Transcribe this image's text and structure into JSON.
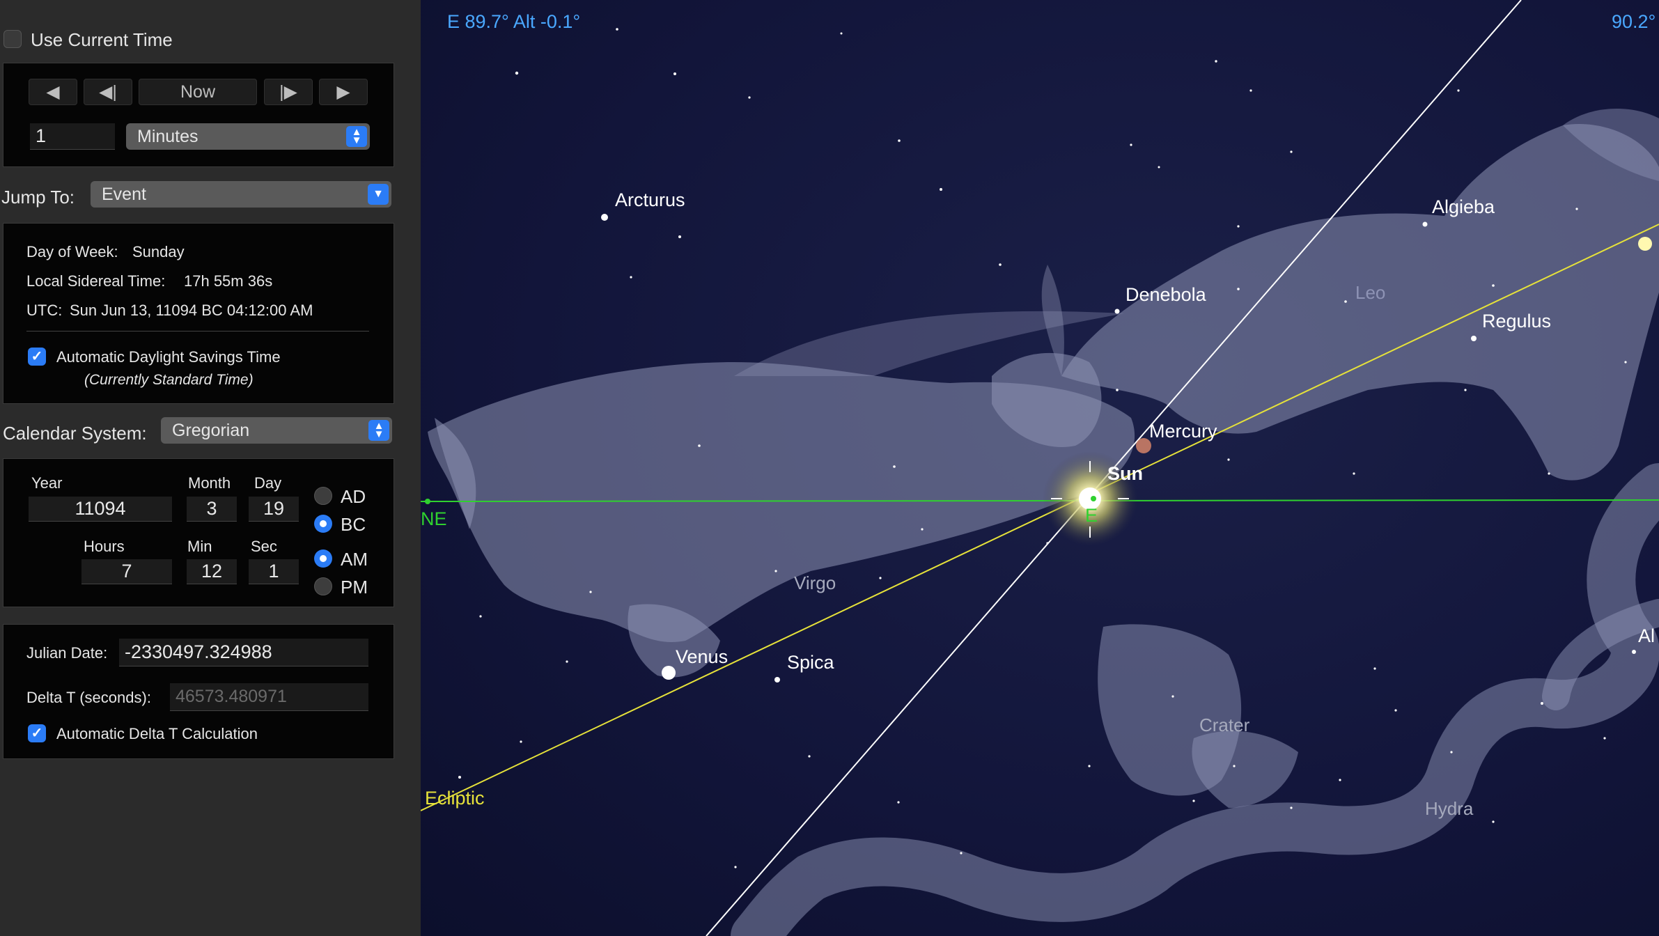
{
  "panel": {
    "use_current_time_label": "Use Current Time",
    "nav": {
      "back_icon": "triangle-left-icon",
      "step_back_icon": "step-back-icon",
      "now_label": "Now",
      "step_forward_icon": "step-forward-icon",
      "forward_icon": "triangle-right-icon",
      "step_value": "1",
      "step_unit": "Minutes"
    },
    "jump_to": {
      "label": "Jump To:",
      "value": "Event"
    },
    "info": {
      "day_of_week_label": "Day of Week:",
      "day_of_week_value": "Sunday",
      "sidereal_label": "Local Sidereal Time:",
      "sidereal_value": "17h 55m 36s",
      "utc_label": "UTC:",
      "utc_value": "Sun Jun 13, 11094 BC 04:12:00 AM",
      "dst_label": "Automatic Daylight Savings Time",
      "dst_status": "(Currently Standard Time)"
    },
    "calendar": {
      "label": "Calendar System:",
      "value": "Gregorian"
    },
    "date": {
      "year_label": "Year",
      "year": "11094",
      "month_label": "Month",
      "month": "3",
      "day_label": "Day",
      "day": "19",
      "hours_label": "Hours",
      "hours": "7",
      "min_label": "Min",
      "min": "12",
      "sec_label": "Sec",
      "sec": "1",
      "ad_label": "AD",
      "bc_label": "BC",
      "am_label": "AM",
      "pm_label": "PM"
    },
    "julian": {
      "label": "Julian Date:",
      "value": "-2330497.324988",
      "delta_label": "Delta T (seconds):",
      "delta_value": "46573.480971",
      "auto_delta_label": "Automatic Delta T Calculation"
    }
  },
  "sky": {
    "readout": "E 89.7° Alt -0.1°",
    "readout_right": "90.2°",
    "stars": {
      "arcturus": "Arcturus",
      "denebola": "Denebola",
      "algieba": "Algieba",
      "regulus": "Regulus",
      "mercury": "Mercury",
      "sun": "Sun",
      "venus": "Venus",
      "spica": "Spica",
      "al_partial": "Al"
    },
    "constellations": {
      "leo": "Leo",
      "virgo": "Virgo",
      "crater": "Crater",
      "hydra": "Hydra"
    },
    "horizon": {
      "east": "E",
      "northeast": "NE"
    },
    "ecliptic_label": "Ecliptic",
    "colors": {
      "horizon": "#2fd12f",
      "ecliptic": "#e6e23a",
      "readout": "#4aa8ff",
      "sun_glow": "#f6f3a0"
    }
  }
}
